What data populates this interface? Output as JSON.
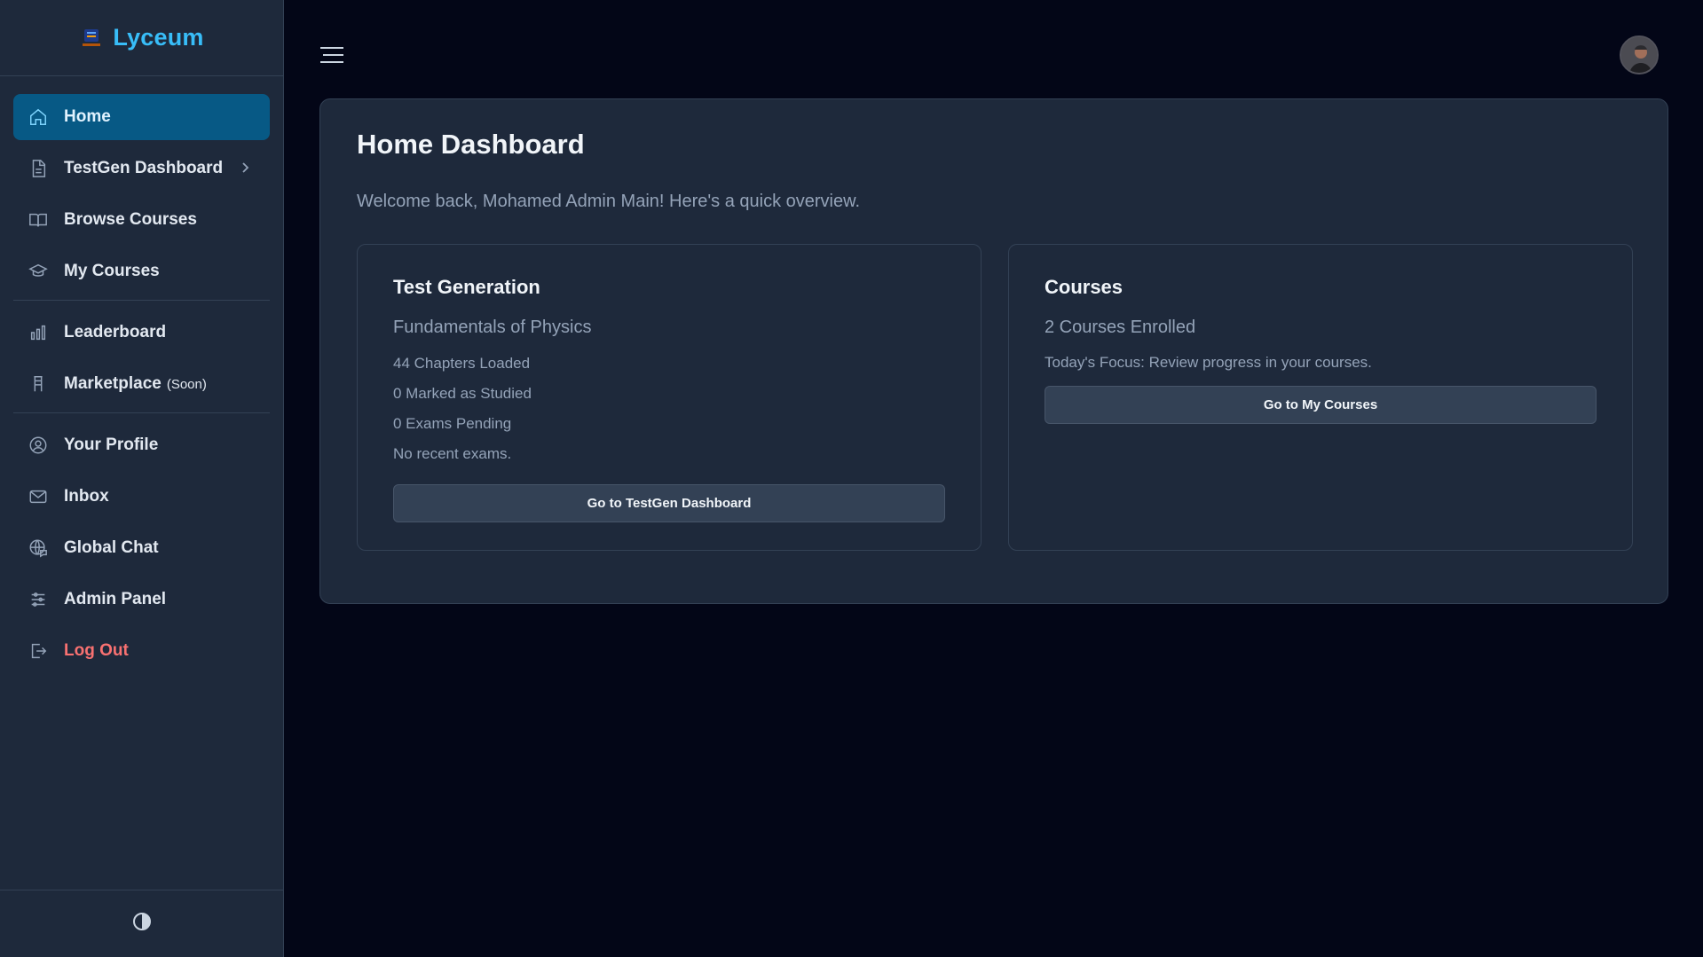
{
  "brand": {
    "name": "Lyceum"
  },
  "sidebar": {
    "items": [
      {
        "label": "Home",
        "icon": "home-icon",
        "active": true
      },
      {
        "label": "TestGen Dashboard",
        "icon": "document-icon",
        "has_submenu": true
      },
      {
        "label": "Browse Courses",
        "icon": "book-open-icon"
      },
      {
        "label": "My Courses",
        "icon": "graduation-cap-icon"
      },
      {
        "label": "Leaderboard",
        "icon": "bar-chart-icon"
      },
      {
        "label": "Marketplace",
        "badge": "(Soon)",
        "icon": "store-icon"
      },
      {
        "label": "Your Profile",
        "icon": "user-circle-icon"
      },
      {
        "label": "Inbox",
        "icon": "mail-icon"
      },
      {
        "label": "Global Chat",
        "icon": "globe-chat-icon"
      },
      {
        "label": "Admin Panel",
        "icon": "sliders-icon"
      },
      {
        "label": "Log Out",
        "icon": "logout-icon"
      }
    ],
    "footer_icon": "theme-toggle-icon"
  },
  "header": {
    "menu_icon": "hamburger-menu-icon",
    "avatar_icon": "user-avatar"
  },
  "main": {
    "title": "Home Dashboard",
    "welcome": "Welcome back, Mohamed Admin Main! Here's a quick overview.",
    "test_card": {
      "title": "Test Generation",
      "subtitle": "Fundamentals of Physics",
      "lines": [
        "44 Chapters Loaded",
        "0 Marked as Studied",
        "0 Exams Pending",
        "No recent exams."
      ],
      "button": "Go to TestGen Dashboard"
    },
    "courses_card": {
      "title": "Courses",
      "subtitle": "2 Courses Enrolled",
      "line": "Today's Focus: Review progress in your courses.",
      "button": "Go to My Courses"
    }
  },
  "colors": {
    "background": "#030617",
    "sidebar": "#1e293b",
    "accent": "#38bdf8",
    "active_item": "#075985",
    "logout": "#f87171"
  }
}
